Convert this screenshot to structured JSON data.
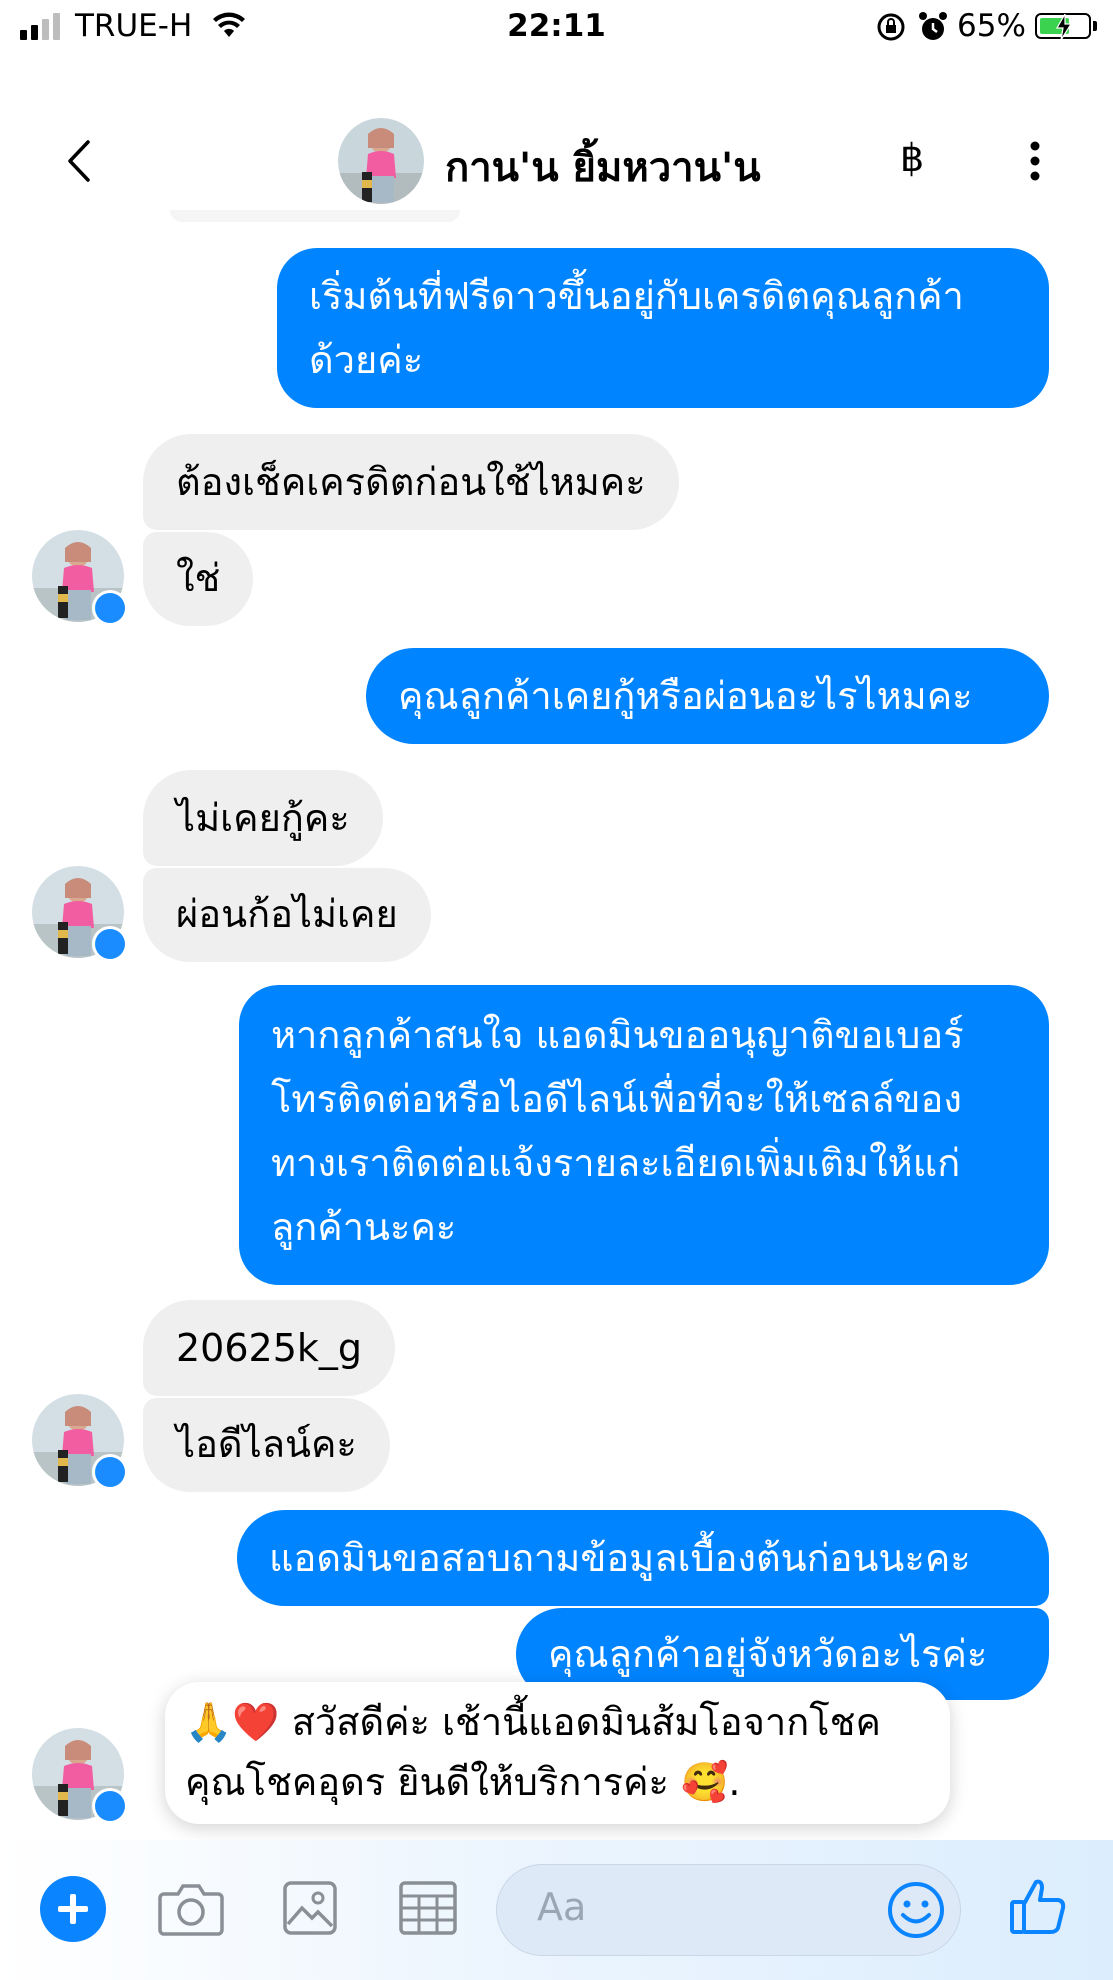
{
  "status_bar": {
    "carrier": "TRUE-H",
    "time": "22:11",
    "battery_percent": "65%",
    "battery_level": 0.65,
    "icons": [
      "signal-icon",
      "wifi-icon",
      "rotation-lock-icon",
      "alarm-icon",
      "battery-charging-icon"
    ]
  },
  "header": {
    "contact_name": "กาน'น ยิ้มหวาน'น",
    "baht_label": "฿",
    "icons": [
      "back-icon",
      "avatar",
      "baht-icon",
      "more-icon"
    ]
  },
  "messages": [
    {
      "side": "out",
      "lines": [
        "เริ่มต้นที่ฟรีดาวขึ้นอยู่กับเครดิตคุณลูกค้า",
        "ด้วยค่ะ"
      ]
    },
    {
      "side": "in",
      "lines": [
        "ต้องเช็คเครดิตก่อนใช้ไหมคะ"
      ]
    },
    {
      "side": "in",
      "lines": [
        "ใช่"
      ]
    },
    {
      "side": "out",
      "lines": [
        "คุณลูกค้าเคยกู้หรือผ่อนอะไรไหมคะ"
      ]
    },
    {
      "side": "in",
      "lines": [
        "ไม่เคยกู้คะ"
      ]
    },
    {
      "side": "in",
      "lines": [
        "ผ่อนก้อไม่เคย"
      ]
    },
    {
      "side": "out",
      "lines": [
        "หากลูกค้าสนใจ แอดมินขออนุญาติขอเบอร์",
        "โทรติดต่อหรือไอดีไลน์เพื่อที่จะให้เซลล์ของ",
        "ทางเราติดต่อแจ้งรายละเอียดเพิ่มเติมให้แก่",
        "ลูกค้านะคะ"
      ]
    },
    {
      "side": "in",
      "lines": [
        "20625k_g"
      ]
    },
    {
      "side": "in",
      "lines": [
        "ไอดีไลน์คะ"
      ]
    },
    {
      "side": "out",
      "lines": [
        "แอดมินขอสอบถามข้อมูลเบื้องต้นก่อนนะคะ"
      ]
    },
    {
      "side": "out",
      "lines": [
        "คุณลูกค้าอยู่จังหวัดอะไรค่ะ"
      ]
    }
  ],
  "popup": {
    "emoji_prefix": "🙏❤️",
    "line1": "สวัสดีค่ะ เช้านี้แอดมินส้มโอจากโชค",
    "line2": "คุณโชคอุดร ยินดีให้บริการค่ะ",
    "emoji_suffix": "🥰."
  },
  "composer": {
    "placeholder": "Aa",
    "icons": [
      "plus-icon",
      "camera-icon",
      "image-icon",
      "sticker-grid-icon",
      "emoji-icon",
      "like-icon"
    ]
  },
  "colors": {
    "outgoing": "#0084ff",
    "incoming": "#efefef",
    "accent": "#0a84ff"
  }
}
